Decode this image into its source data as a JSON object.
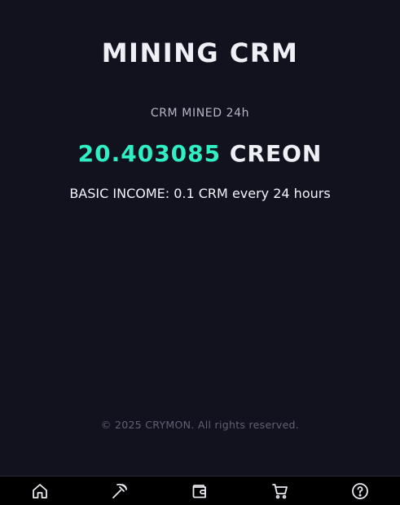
{
  "header": {
    "title": "MINING CRM"
  },
  "mining": {
    "label": "CRM MINED 24h",
    "amount": "20.403085",
    "unit": "CREON",
    "income_text": "BASIC INCOME: 0.1 CRM every 24 hours"
  },
  "footer": {
    "copyright": "© 2025 CRYMON. All rights reserved."
  },
  "nav": {
    "items": [
      {
        "icon": "home-icon"
      },
      {
        "icon": "pickaxe-icon"
      },
      {
        "icon": "wallet-icon"
      },
      {
        "icon": "cart-icon"
      },
      {
        "icon": "help-icon"
      }
    ]
  },
  "colors": {
    "background": "#12121f",
    "accent": "#2ef0c4",
    "nav_background": "#000000"
  }
}
